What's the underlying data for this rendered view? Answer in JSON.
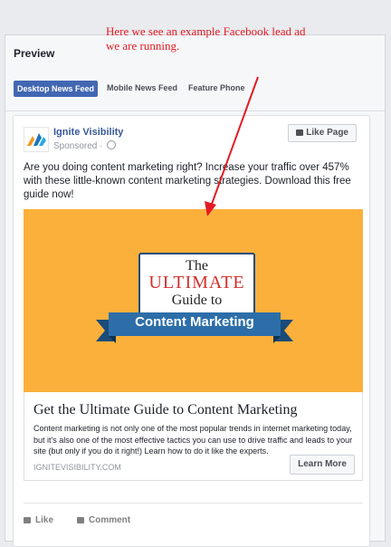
{
  "annotation": {
    "line1": "Here we see an example Facebook lead ad",
    "line2": "we are running."
  },
  "preview": {
    "title": "Preview",
    "tabs": [
      {
        "label": "Desktop News Feed",
        "active": true
      },
      {
        "label": "Mobile News Feed",
        "active": false
      },
      {
        "label": "Feature Phone",
        "active": false
      }
    ]
  },
  "post": {
    "page_name": "Ignite Visibility",
    "sponsored": "Sponsored · ",
    "like_page": "Like Page",
    "text": "Are you doing content marketing right? Increase your traffic over 457% with these little-known content marketing strategies. Download this free guide now!",
    "image": {
      "line1": "The",
      "line2": "ULTIMATE",
      "line3": "Guide to",
      "ribbon": "Content Marketing",
      "bg_color": "#fbb03b"
    },
    "headline": "Get the Ultimate Guide to Content Marketing",
    "description": "Content marketing is not only one of the most popular trends in internet marketing today, but it's also one of the most effective tactics you can use to drive traffic and leads to your site (but only if you do it right!) Learn how to do it like the experts.",
    "domain": "IGNITEVISIBILITY.COM",
    "cta": "Learn More",
    "actions": {
      "like": "Like",
      "comment": "Comment"
    }
  },
  "colors": {
    "brand_blue": "#4267b2",
    "annotation_red": "#e31b23",
    "link_blue": "#365899"
  }
}
